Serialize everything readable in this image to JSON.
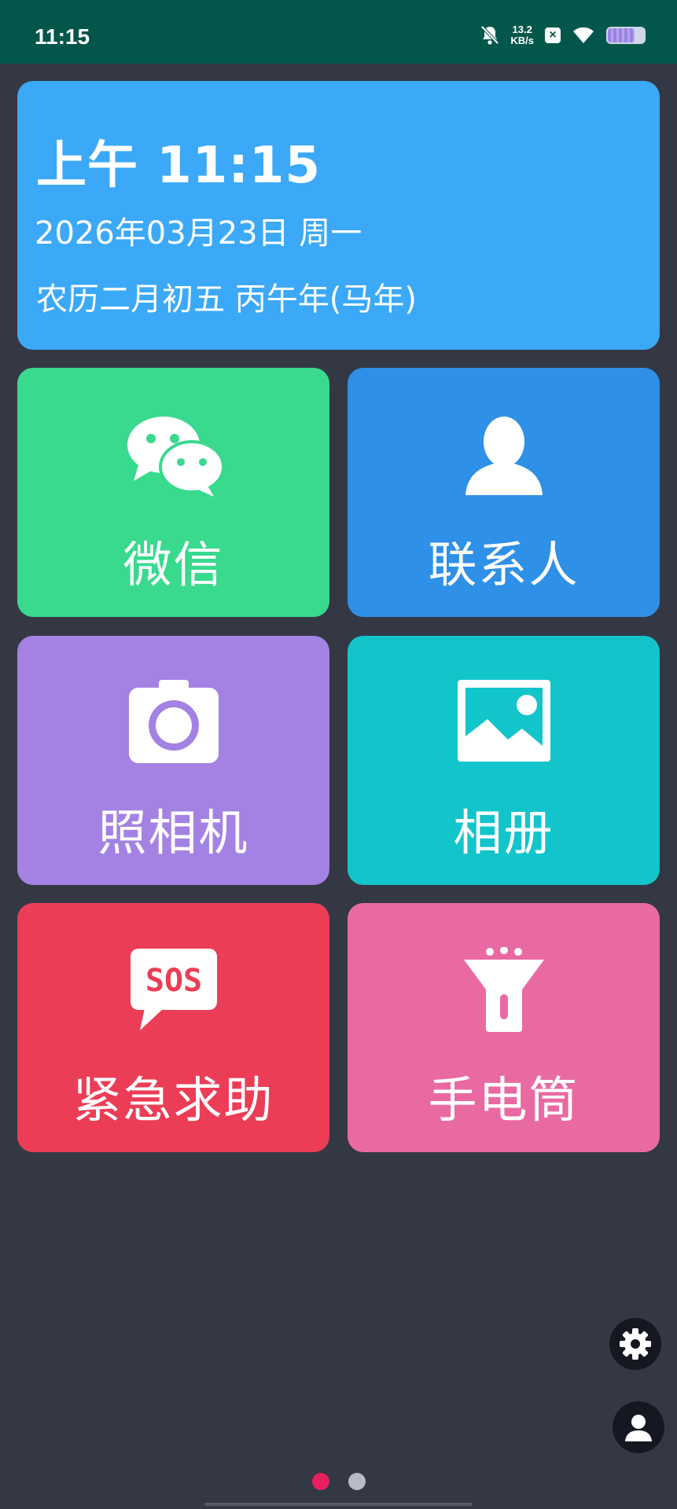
{
  "status_bar": {
    "time": "11:15",
    "net_speed_value": "13.2",
    "net_speed_unit": "KB/s",
    "icons": [
      "bell-off-icon",
      "x-icon",
      "wifi-icon",
      "battery-icon"
    ],
    "battery_level_fraction": 0.75
  },
  "clock_card": {
    "time": "上午 11:15",
    "date": "2026年03月23日 周一",
    "lunar": "农历二月初五 丙午年(马年)",
    "color": "#3ba9f7"
  },
  "tiles": [
    {
      "label": "微信",
      "icon": "wechat-icon",
      "color": "#39d98e"
    },
    {
      "label": "联系人",
      "icon": "contact-person-icon",
      "color": "#2e90e6"
    },
    {
      "label": "照相机",
      "icon": "camera-icon",
      "color": "#a482e3"
    },
    {
      "label": "相册",
      "icon": "photo-album-icon",
      "color": "#12c5cb"
    },
    {
      "label": "紧急求助",
      "icon": "sos-icon",
      "color": "#ec3d56"
    },
    {
      "label": "手电筒",
      "icon": "flashlight-icon",
      "color": "#e96aa3"
    }
  ],
  "floating_buttons": [
    {
      "name": "settings",
      "icon": "gear-icon"
    },
    {
      "name": "profile",
      "icon": "person-icon"
    }
  ],
  "pager": {
    "page_count": 2,
    "current_page": 1,
    "active_color": "#e8205f",
    "inactive_color": "#b8bbc3"
  }
}
